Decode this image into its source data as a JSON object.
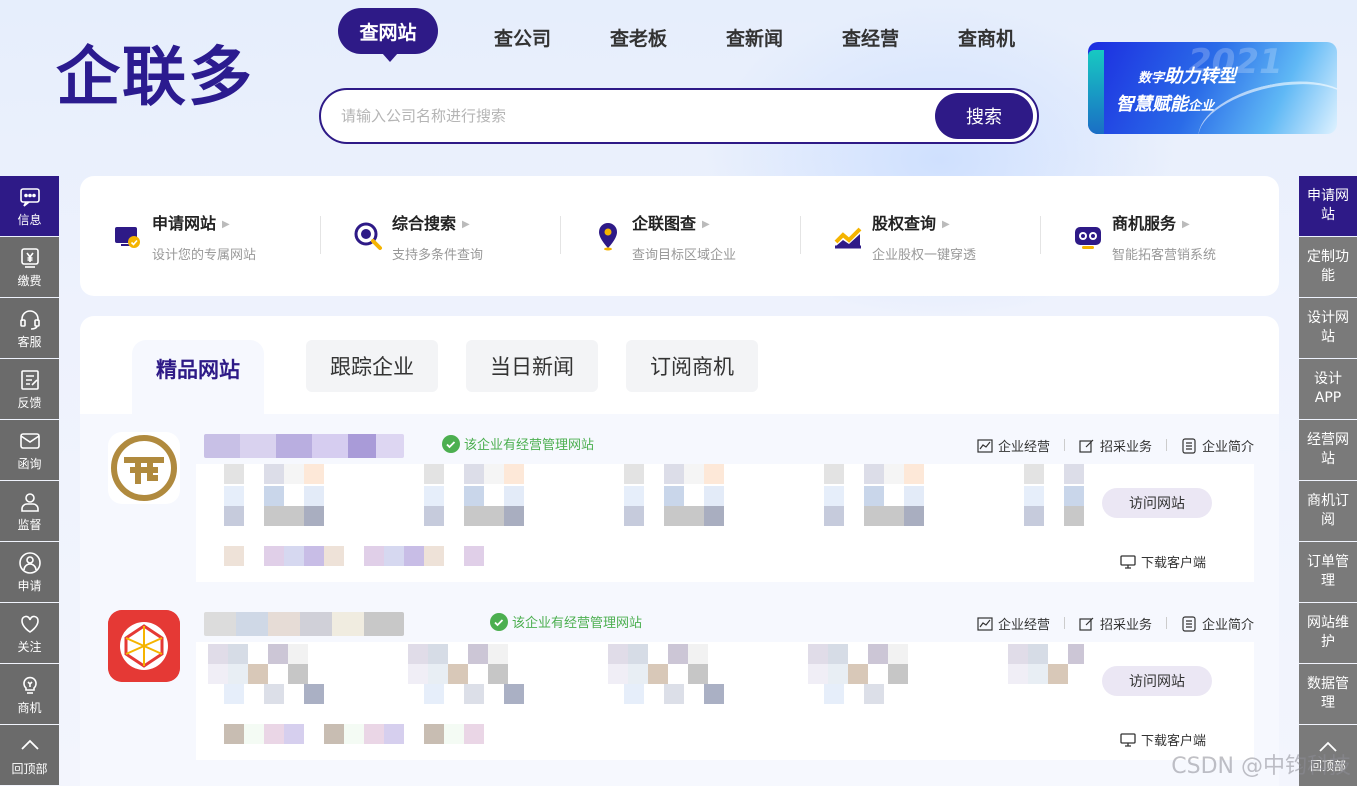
{
  "logo": {
    "text": "企联多"
  },
  "search": {
    "tabs": [
      "查网站",
      "查公司",
      "查老板",
      "查新闻",
      "查经营",
      "查商机"
    ],
    "placeholder": "请输入公司名称进行搜索",
    "button": "搜索"
  },
  "banner": {
    "year": "2021",
    "line1_a": "数字",
    "line1_b": "助力转型",
    "line2_a": "智慧赋能",
    "line2_b": "企业"
  },
  "left_sidebar": {
    "items": [
      {
        "label": "信息",
        "icon": "message-icon"
      },
      {
        "label": "缴费",
        "icon": "yen-icon"
      },
      {
        "label": "客服",
        "icon": "headset-icon"
      },
      {
        "label": "反馈",
        "icon": "edit-icon"
      },
      {
        "label": "函询",
        "icon": "mail-icon"
      },
      {
        "label": "监督",
        "icon": "user-icon"
      },
      {
        "label": "申请",
        "icon": "person-icon"
      },
      {
        "label": "关注",
        "icon": "heart-icon"
      },
      {
        "label": "商机",
        "icon": "bulb-icon"
      },
      {
        "label": "回顶部",
        "icon": "chevron-up-icon"
      }
    ]
  },
  "right_sidebar": {
    "items": [
      "申请网站",
      "定制功能",
      "设计网站",
      "设计APP",
      "经营网站",
      "商机订阅",
      "订单管理",
      "网站维护",
      "数据管理",
      "回顶部"
    ]
  },
  "services": [
    {
      "title": "申请网站",
      "sub": "设计您的专属网站",
      "icon": "website-apply-icon"
    },
    {
      "title": "综合搜索",
      "sub": "支持多条件查询",
      "icon": "search-icon"
    },
    {
      "title": "企联图查",
      "sub": "查询目标区域企业",
      "icon": "location-pin-icon"
    },
    {
      "title": "股权查询",
      "sub": "企业股权一键穿透",
      "icon": "chart-icon"
    },
    {
      "title": "商机服务",
      "sub": "智能拓客营销系统",
      "icon": "robot-icon"
    }
  ],
  "content_tabs": [
    "精品网站",
    "跟踪企业",
    "当日新闻",
    "订阅商机"
  ],
  "companies": [
    {
      "badge": "该企业有经营管理网站",
      "links": [
        "企业经营",
        "招采业务",
        "企业简介"
      ],
      "visit": "访问网站",
      "download": "下载客户端"
    },
    {
      "badge": "该企业有经营管理网站",
      "links": [
        "企业经营",
        "招采业务",
        "企业简介"
      ],
      "visit": "访问网站",
      "download": "下载客户端"
    }
  ],
  "watermark": "CSDN @中钧科技",
  "colors": {
    "brand": "#2e1a87",
    "sidebar": "#6b6b6b",
    "success": "#4caf50"
  }
}
